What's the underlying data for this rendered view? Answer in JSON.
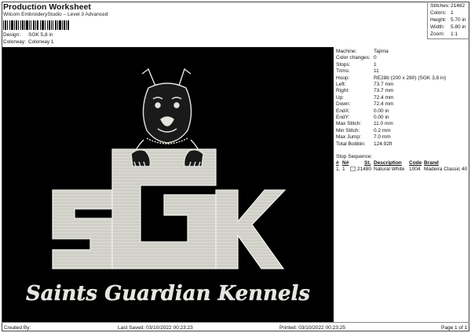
{
  "header": {
    "title": "Production Worksheet",
    "subtitle": "Wilcom EmbroideryStudio – Level 3 Advanced",
    "design_label": "Design:",
    "design_value": "SGK 5,8 in",
    "colorway_label": "Colorway:",
    "colorway_value": "Colorway 1"
  },
  "summary": {
    "stitches_label": "Stitches:",
    "stitches": "21482",
    "colors_label": "Colors:",
    "colors": "1",
    "height_label": "Height:",
    "height": "5.70 in",
    "width_label": "Width:",
    "width": "5.80 in",
    "zoom_label": "Zoom:",
    "zoom": "1:1"
  },
  "design": {
    "text_logo": "SGK",
    "tagline": "Saints Guardian Kennels",
    "thread_color": "#dcdcd6",
    "background_color": "#000000"
  },
  "machine_info": [
    {
      "label": "Machine:",
      "value": "Tajima"
    },
    {
      "label": "Color changes:",
      "value": "0"
    },
    {
      "label": "Stops:",
      "value": "1"
    },
    {
      "label": "Trims:",
      "value": "11"
    },
    {
      "label": "Hoop:",
      "value": "RE28b (200 x 280) (SGK 3,8 in)"
    },
    {
      "label": "Left:",
      "value": "73.7 mm"
    },
    {
      "label": "Right:",
      "value": "73.7 mm"
    },
    {
      "label": "Up:",
      "value": "72.4 mm"
    },
    {
      "label": "Down:",
      "value": "72.4 mm"
    },
    {
      "label": "EndX:",
      "value": "0.00 in"
    },
    {
      "label": "EndY:",
      "value": "0.00 in"
    },
    {
      "label": "Max Stitch:",
      "value": "11.0 mm"
    },
    {
      "label": "Min Stitch:",
      "value": "0.2 mm"
    },
    {
      "label": "Max Jump:",
      "value": "7.0 mm"
    },
    {
      "label": "Total Bobbin:",
      "value": "124.92ft"
    }
  ],
  "stop_sequence": {
    "title": "Stop Sequence:",
    "headers": {
      "num": "#",
      "n": "N#",
      "st": "St.",
      "description": "Description",
      "code": "Code",
      "brand": "Brand"
    },
    "rows": [
      {
        "num": "1.",
        "n": "1",
        "st": "21480",
        "description": "Natural White",
        "code": "1004",
        "brand": "Madeira Classic 40"
      }
    ]
  },
  "footer": {
    "created_by": "Created By:",
    "last_saved": "Last Saved: 03/10/2022 00:23:23",
    "printed": "Printed: 03/10/2022 00:23:25",
    "page": "Page 1 of 1"
  }
}
